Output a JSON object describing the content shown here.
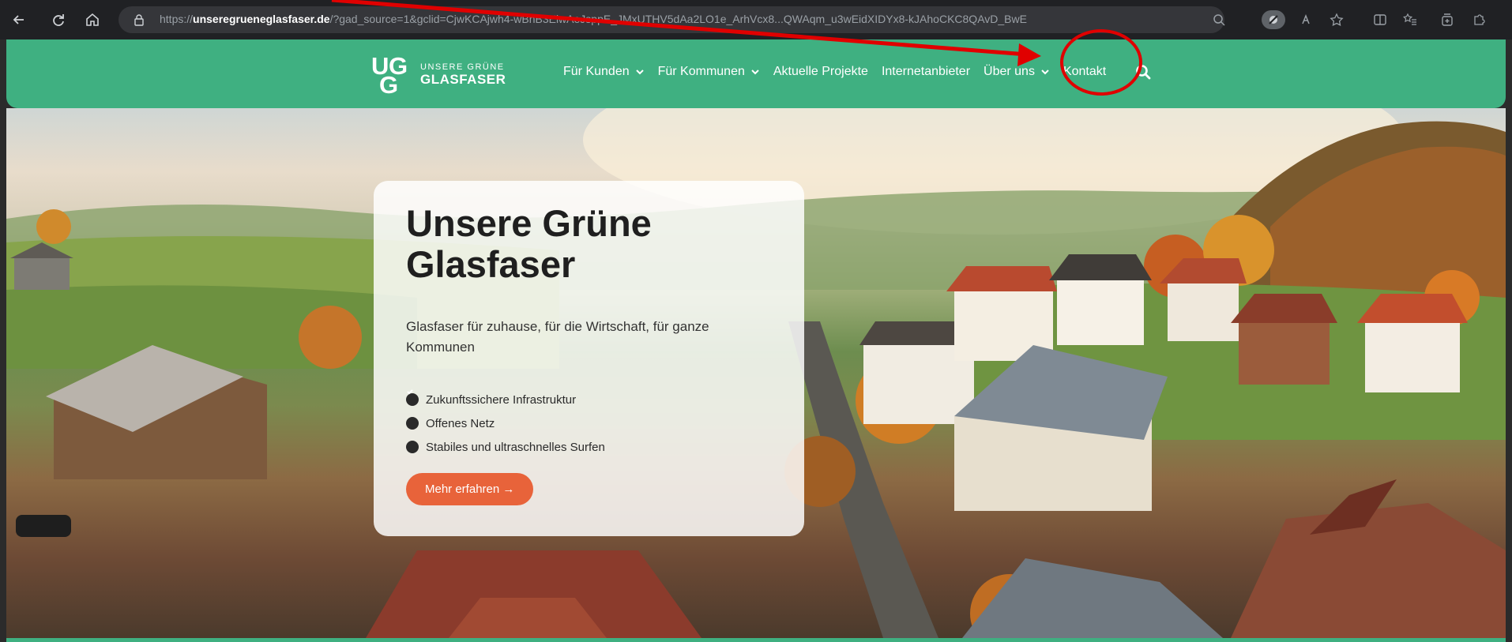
{
  "browser": {
    "url_prefix": "https://",
    "url_domain": "unseregrueneglasfaser.de",
    "url_rest": "/?gad_source=1&gclid=CjwKCAjwh4-wBhB3EiwAeJsppE_JMxUTHV5dAa2LO1e_ArhVcx8...QWAqm_u3wEidXIDYx8-kJAhoCKC8QAvD_BwE"
  },
  "header": {
    "logo": {
      "mark_letters": [
        "U",
        "G",
        "G"
      ],
      "line1": "UNSERE GRÜNE",
      "line2": "GLASFASER"
    },
    "nav": [
      {
        "label": "Für Kunden",
        "dropdown": true
      },
      {
        "label": "Für Kommunen",
        "dropdown": true
      },
      {
        "label": "Aktuelle Projekte",
        "dropdown": false
      },
      {
        "label": "Internetanbieter",
        "dropdown": false
      },
      {
        "label": "Über uns",
        "dropdown": true
      },
      {
        "label": "Kontakt",
        "dropdown": false
      }
    ]
  },
  "hero": {
    "title": "Unsere Grüne Glasfaser",
    "subtitle": "Glasfaser für zuhause, für die Wirtschaft, für ganze Kommunen",
    "features": [
      "Zukunftssichere Infrastruktur",
      "Offenes Netz",
      "Stabiles und ultraschnelles Surfen"
    ],
    "cta_label": "Mehr erfahren →"
  },
  "colors": {
    "brand_green": "#3fb081",
    "cta_orange": "#e8633a",
    "annotation_red": "#e00000"
  },
  "icons": {
    "back": "arrow-left-icon",
    "reload": "reload-icon",
    "home": "home-icon",
    "site_info": "lock-icon",
    "search": "search-icon",
    "check": "check-circle-icon"
  }
}
